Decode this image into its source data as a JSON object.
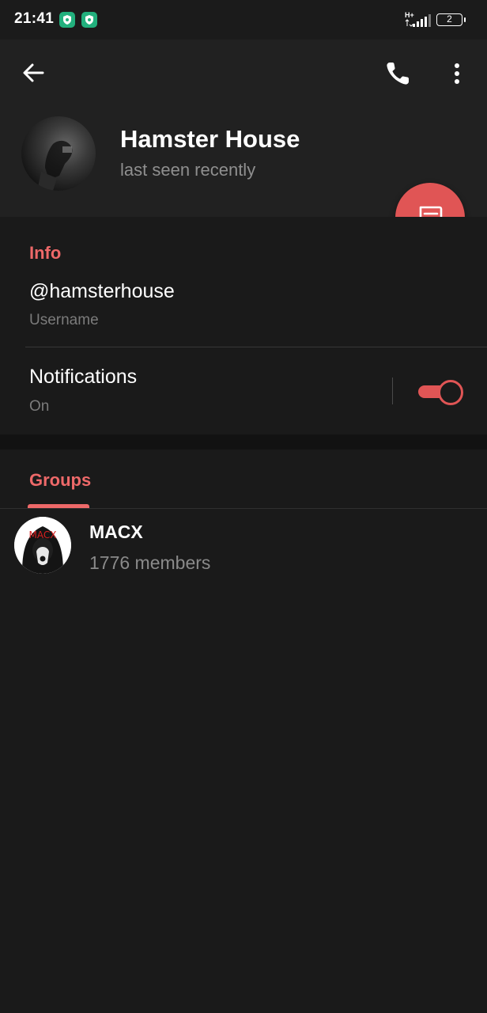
{
  "status_bar": {
    "time": "21:41",
    "network": "H+",
    "battery": "2",
    "app_icons": [
      "shield-app-icon",
      "shield-app-icon"
    ]
  },
  "header": {
    "name": "Hamster House",
    "status": "last seen recently",
    "icons": {
      "back": "arrow-left-icon",
      "call": "phone-icon",
      "more": "more-vertical-icon",
      "fab": "message-icon"
    }
  },
  "info": {
    "title": "Info",
    "username_value": "@hamsterhouse",
    "username_label": "Username",
    "notifications_value": "Notifications",
    "notifications_label": "On",
    "notifications_enabled": true
  },
  "groups": {
    "tab_label": "Groups",
    "items": [
      {
        "name": "MACX",
        "members": "1776 members",
        "avatar_text": "MACX"
      }
    ]
  },
  "colors": {
    "accent": "#e05555",
    "accent_text": "#ee6969",
    "background": "#1a1a1a",
    "header": "#212121"
  }
}
